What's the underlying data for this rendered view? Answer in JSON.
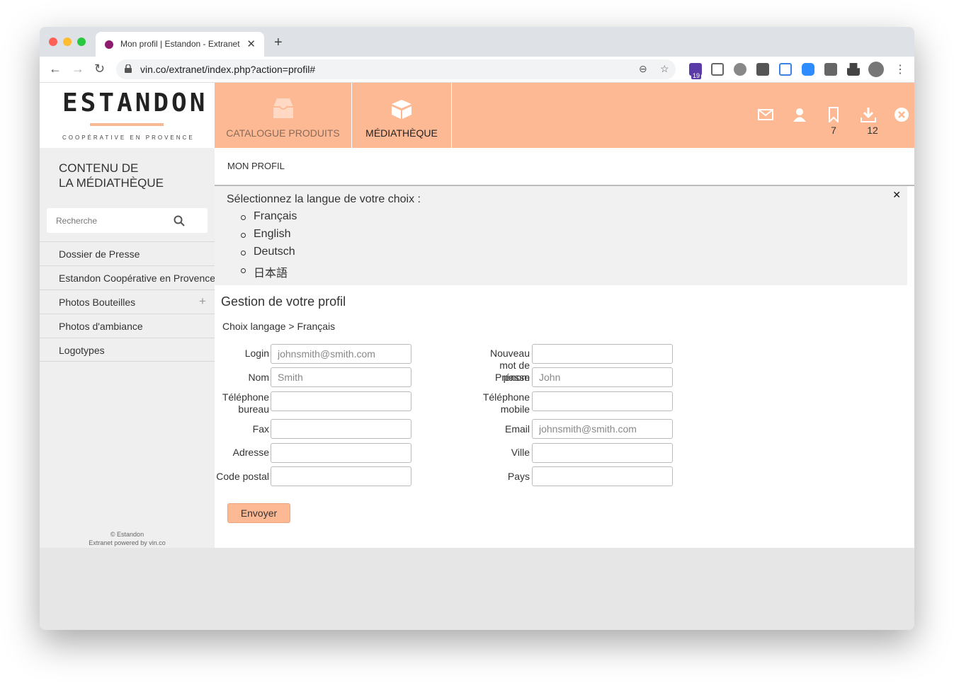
{
  "browser": {
    "tab_title": "Mon profil | Estandon - Extranet",
    "url": "vin.co/extranet/index.php?action=profil#",
    "extension_badge": "19"
  },
  "logo": {
    "name": "ESTANDON",
    "tagline": "COOPÉRATIVE EN PROVENCE"
  },
  "topnav": {
    "tabs": [
      {
        "label": "CATALOGUE PRODUITS",
        "icon": "inbox-icon"
      },
      {
        "label": "MÉDIATHÈQUE",
        "icon": "box-icon"
      }
    ],
    "bookmarks_count": "7",
    "downloads_count": "12"
  },
  "sidebar": {
    "title_line1": "CONTENU DE",
    "title_line2": "LA MÉDIATHÈQUE",
    "search_placeholder": "Recherche",
    "items": [
      {
        "label": "Dossier de Presse"
      },
      {
        "label": "Estandon Coopérative en Provence"
      },
      {
        "label": "Photos Bouteilles",
        "expand": "+"
      },
      {
        "label": "Photos d'ambiance"
      },
      {
        "label": "Logotypes"
      }
    ],
    "footer_line1": "© Estandon",
    "footer_line2": "Extranet powered by vin.co"
  },
  "main": {
    "breadcrumb": "MON PROFIL",
    "language_prompt": "Sélectionnez la langue de votre choix :",
    "languages": [
      "Français",
      "English",
      "Deutsch",
      "日本語"
    ],
    "form_title": "Gestion de votre profil",
    "language_choice": "Choix langage > Français",
    "fields": {
      "login": {
        "label": "Login",
        "value": "johnsmith@smith.com"
      },
      "new_password": {
        "label": "Nouveau mot de passe",
        "value": ""
      },
      "nom": {
        "label": "Nom",
        "value": "Smith"
      },
      "prenom": {
        "label": "Prénom",
        "value": "John"
      },
      "tel_bureau": {
        "label": "Téléphone bureau",
        "value": ""
      },
      "tel_mobile": {
        "label": "Téléphone mobile",
        "value": ""
      },
      "fax": {
        "label": "Fax",
        "value": ""
      },
      "email": {
        "label": "Email",
        "value": "johnsmith@smith.com"
      },
      "adresse": {
        "label": "Adresse",
        "value": ""
      },
      "ville": {
        "label": "Ville",
        "value": ""
      },
      "code_postal": {
        "label": "Code postal",
        "value": ""
      },
      "pays": {
        "label": "Pays",
        "value": ""
      }
    },
    "submit_label": "Envoyer"
  },
  "colors": {
    "accent": "#fdb993",
    "sidebar_bg": "#efefef",
    "tab_favicon": "#8e1c6e"
  }
}
